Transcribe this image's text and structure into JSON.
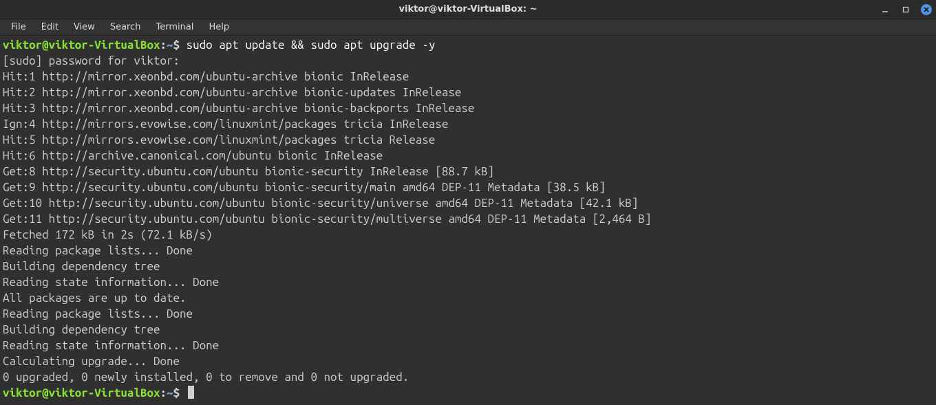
{
  "window": {
    "title": "viktor@viktor-VirtualBox: ~"
  },
  "menubar": {
    "items": [
      "File",
      "Edit",
      "View",
      "Search",
      "Terminal",
      "Help"
    ]
  },
  "prompt": {
    "user_host": "viktor@viktor-VirtualBox",
    "sep1": ":",
    "path": "~",
    "sep2": "$ "
  },
  "command": "sudo apt update && sudo apt upgrade -y",
  "output_lines": [
    "[sudo] password for viktor: ",
    "Hit:1 http://mirror.xeonbd.com/ubuntu-archive bionic InRelease",
    "Hit:2 http://mirror.xeonbd.com/ubuntu-archive bionic-updates InRelease",
    "Hit:3 http://mirror.xeonbd.com/ubuntu-archive bionic-backports InRelease",
    "Ign:4 http://mirrors.evowise.com/linuxmint/packages tricia InRelease",
    "Hit:5 http://mirrors.evowise.com/linuxmint/packages tricia Release",
    "Hit:6 http://archive.canonical.com/ubuntu bionic InRelease",
    "Get:8 http://security.ubuntu.com/ubuntu bionic-security InRelease [88.7 kB]",
    "Get:9 http://security.ubuntu.com/ubuntu bionic-security/main amd64 DEP-11 Metadata [38.5 kB]",
    "Get:10 http://security.ubuntu.com/ubuntu bionic-security/universe amd64 DEP-11 Metadata [42.1 kB]",
    "Get:11 http://security.ubuntu.com/ubuntu bionic-security/multiverse amd64 DEP-11 Metadata [2,464 B]",
    "Fetched 172 kB in 2s (72.1 kB/s)",
    "Reading package lists... Done",
    "Building dependency tree       ",
    "Reading state information... Done",
    "All packages are up to date.",
    "Reading package lists... Done",
    "Building dependency tree       ",
    "Reading state information... Done",
    "Calculating upgrade... Done",
    "0 upgraded, 0 newly installed, 0 to remove and 0 not upgraded."
  ]
}
